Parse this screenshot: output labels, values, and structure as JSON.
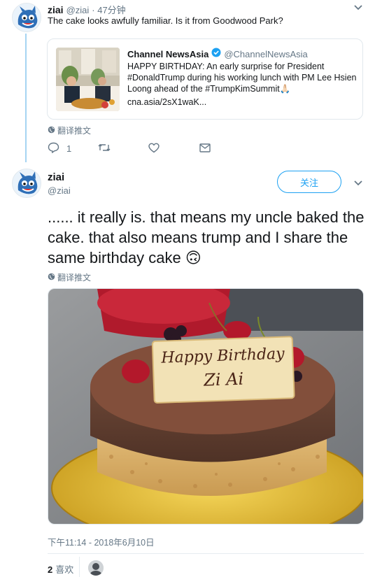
{
  "reply_tweet": {
    "author_name": "ziai",
    "author_handle": "@ziai",
    "time_ago": "· 47分钟",
    "text": "The cake looks awfully familiar. Is it from Goodwood Park?",
    "quote": {
      "name": "Channel NewsAsia",
      "handle": "@ChannelNewsAsia",
      "body": "HAPPY BIRTHDAY: An early surprise for President #DonaldTrump during his working lunch with PM Lee Hsien Loong ahead of the #TrumpKimSummit🙏🏻",
      "link": "cna.asia/2sX1waK..."
    },
    "translate_label": "翻译推文",
    "actions": {
      "reply_count": "1"
    }
  },
  "main_tweet": {
    "author_name": "ziai",
    "author_handle": "@ziai",
    "follow_label": "关注",
    "text": "...... it really is. that means my uncle baked the cake. that also means trump and I share the same birthday cake 🙃",
    "translate_label": "翻译推文",
    "image": {
      "plaque_line1": "Happy Birthday",
      "plaque_line2": "Zi Ai"
    },
    "timestamp": "下午11:14 - 2018年6月10日",
    "likes_count": "2",
    "likes_label": "喜欢"
  },
  "icons": {
    "caret": "chevron-down-icon",
    "reply": "reply-icon",
    "retweet": "retweet-icon",
    "like": "heart-icon",
    "dm": "envelope-icon",
    "translate": "globe-icon",
    "verified": "verified-badge-icon"
  },
  "colors": {
    "accent": "#1da1f2",
    "thread_line": "#a6d4f2",
    "secondary_text": "#657786"
  }
}
